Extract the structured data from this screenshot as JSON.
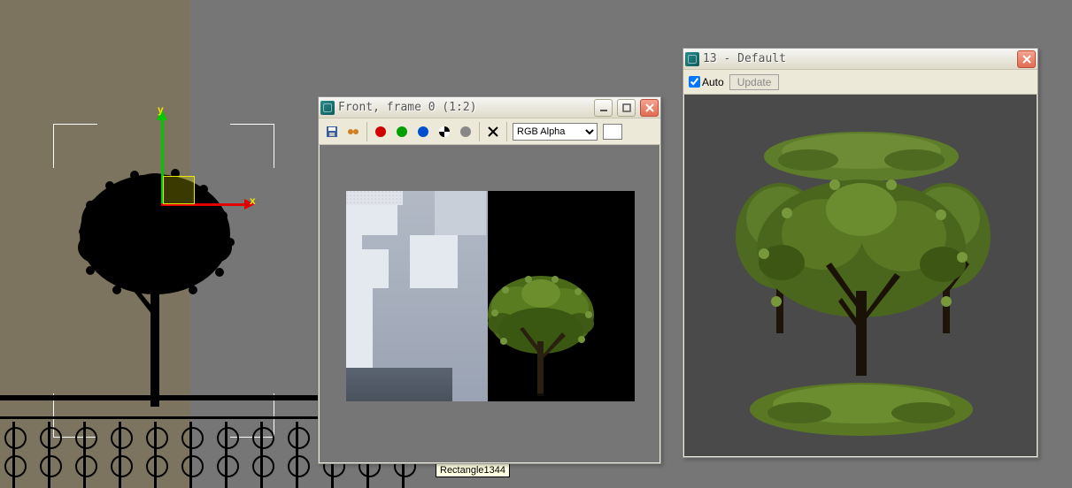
{
  "viewport": {
    "tooltip_label": "Rectangle1344",
    "gizmo": {
      "x_label": "x",
      "y_label": "y"
    }
  },
  "render_window": {
    "title": "Front, frame 0 (1:2)",
    "toolbar": {
      "save_title": "Save",
      "clone_title": "Clone",
      "channel_r_title": "Red channel",
      "channel_g_title": "Green channel",
      "channel_b_title": "Blue channel",
      "channel_alpha_title": "Alpha",
      "channel_mono_title": "Monochrome",
      "clear_title": "Clear",
      "dropdown_selected": "RGB Alpha",
      "dropdown_options": [
        "RGB Alpha"
      ],
      "swatch_color": "#ffffff"
    }
  },
  "material_window": {
    "title": "13 - Default",
    "auto_label": "Auto",
    "auto_checked": true,
    "update_label": "Update"
  },
  "colors": {
    "viewport_bg": "#767676",
    "wall": "#7c745e",
    "accent_red": "#e00000",
    "accent_green": "#00c800",
    "accent_yellow": "#e8e800"
  }
}
